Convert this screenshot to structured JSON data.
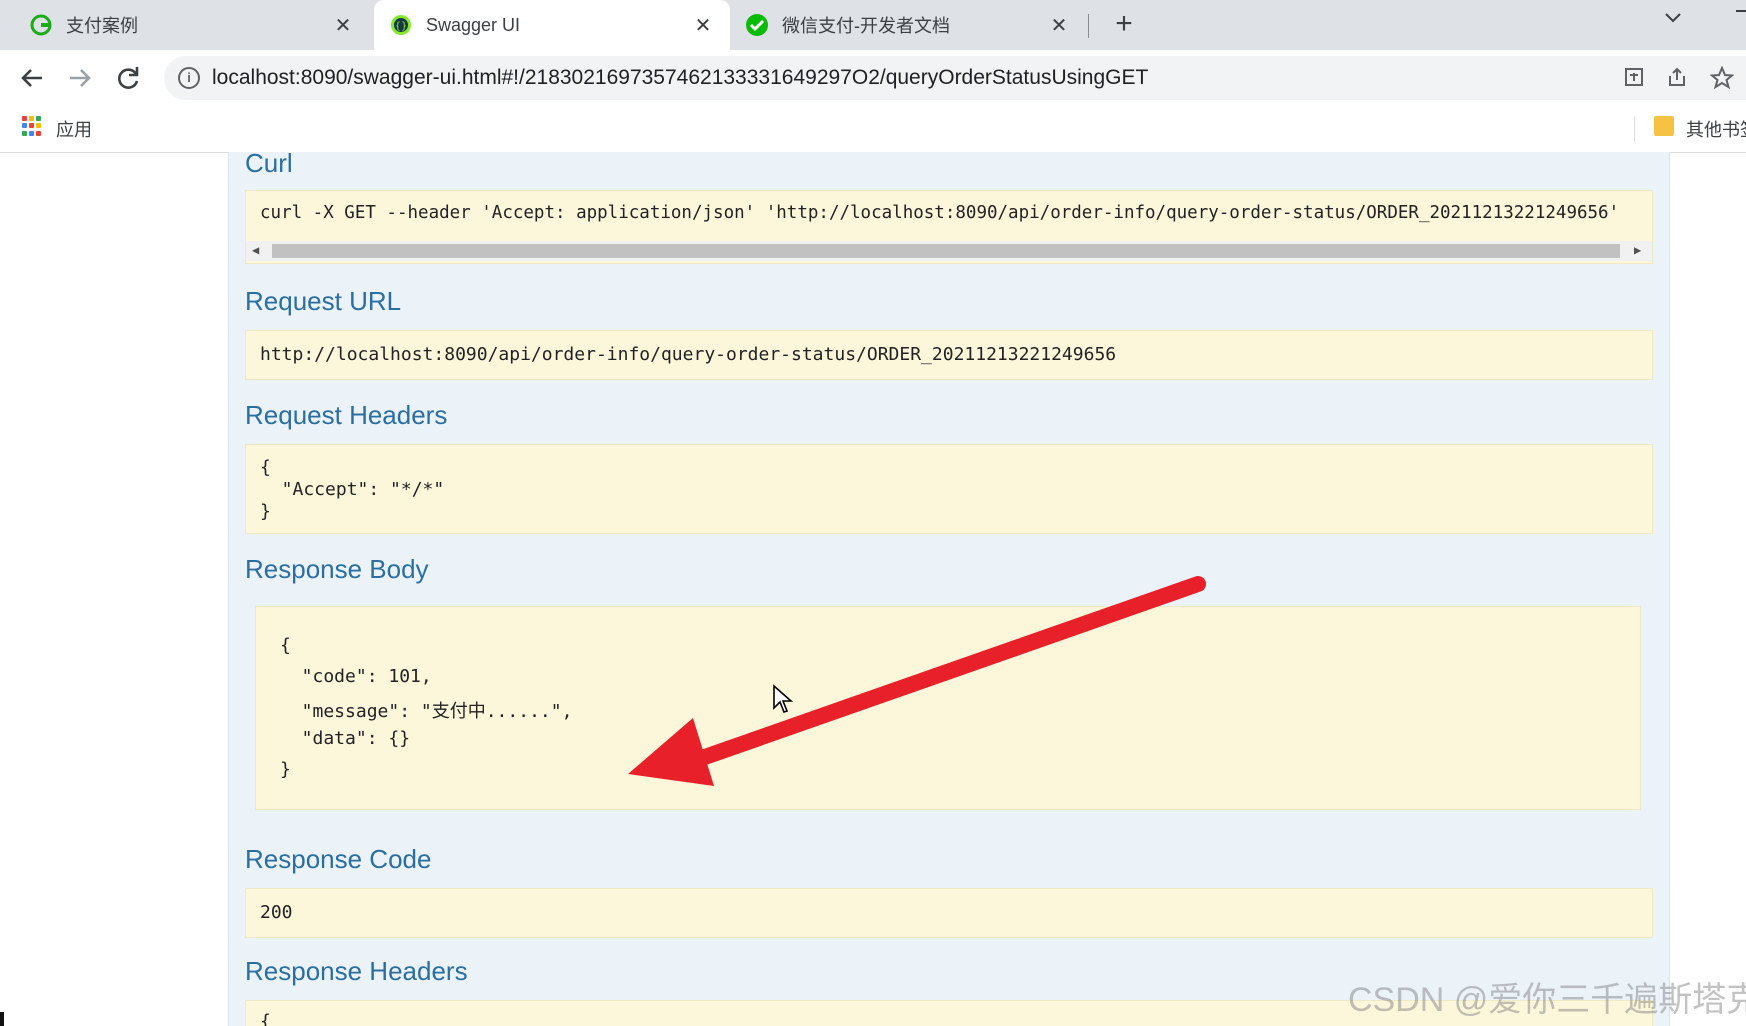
{
  "tabs": [
    {
      "title": "支付案例",
      "icon": "refresh-g-icon",
      "color": "#1aad19",
      "active": false
    },
    {
      "title": "Swagger UI",
      "icon": "swagger-icon",
      "color": "#85ea2d",
      "active": true
    },
    {
      "title": "微信支付-开发者文档",
      "icon": "wechat-pay-icon",
      "color": "#09bb07",
      "active": false
    }
  ],
  "tab_close_glyph": "✕",
  "new_tab_glyph": "+",
  "address_bar": {
    "url": "localhost:8090/swagger-ui.html#!/2183021697357462133331649297O2/queryOrderStatusUsingGET"
  },
  "bookmarks": {
    "apps_label": "应用",
    "other_label": "其他书签"
  },
  "sections": {
    "curl": {
      "heading": "Curl",
      "command": "curl -X GET --header 'Accept: application/json' 'http://localhost:8090/api/order-info/query-order-status/ORDER_20211213221249656'"
    },
    "request_url": {
      "heading": "Request URL",
      "value": "http://localhost:8090/api/order-info/query-order-status/ORDER_20211213221249656"
    },
    "request_headers": {
      "heading": "Request Headers",
      "lines": [
        "{",
        "  \"Accept\": \"*/*\"",
        "}"
      ]
    },
    "response_body": {
      "heading": "Response Body",
      "lines": [
        "{",
        "  \"code\": 101,",
        "  \"message\": \"支付中......\",",
        "  \"data\": {}",
        "}"
      ]
    },
    "response_code": {
      "heading": "Response Code",
      "value": "200"
    },
    "response_headers": {
      "heading": "Response Headers",
      "lines": [
        "{"
      ]
    }
  },
  "watermark": "CSDN @爱你三千遍斯塔克",
  "colors": {
    "annotation_arrow": "#e8202a",
    "section_heading": "#2b6ea1",
    "code_background": "#fcf6db",
    "panel_background": "#ebf3f9"
  }
}
